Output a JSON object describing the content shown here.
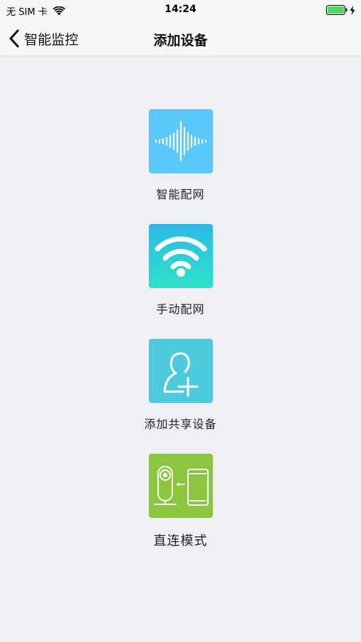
{
  "status_bar": {
    "carrier": "无 SIM 卡",
    "time": "14:24",
    "wifi_icon": "wifi-icon",
    "battery_icon": "battery-charging-icon",
    "battery_color": "#4cd964"
  },
  "nav": {
    "back_label": "智能监控",
    "title": "添加设备"
  },
  "options": [
    {
      "label": "智能配网",
      "icon": "sound-wave-icon",
      "color": "#5bc8fa"
    },
    {
      "label": "手动配网",
      "icon": "wifi-signal-icon",
      "color": "#2bc9d8"
    },
    {
      "label": "添加共享设备",
      "icon": "add-user-icon",
      "color": "#4dcadb"
    },
    {
      "label": "直连模式",
      "icon": "camera-to-phone-icon",
      "color": "#8cc63f"
    }
  ]
}
